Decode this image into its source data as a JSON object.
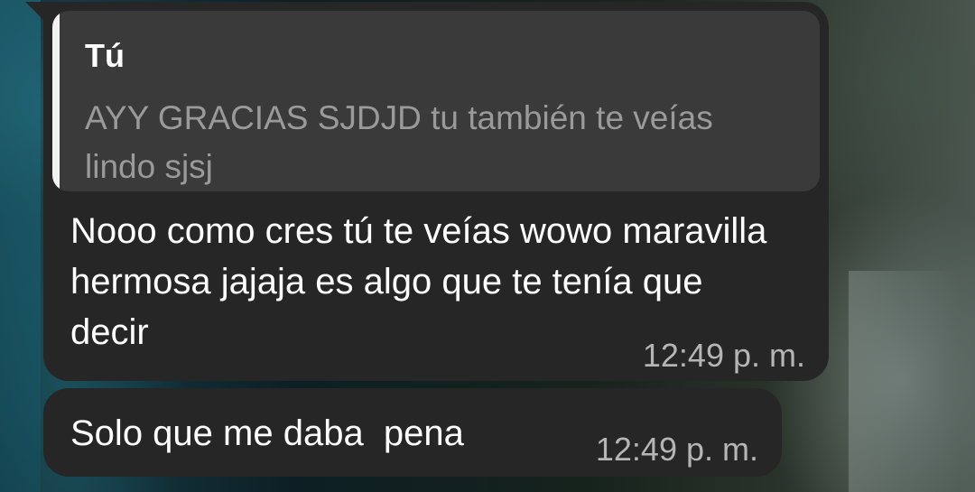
{
  "messages": [
    {
      "quoted": {
        "author": "Tú",
        "text": "AYY GRACIAS SJDJD tu también te veías lindo sjsj"
      },
      "text": "Nooo como cres tú te veías wowo maravilla hermosa jajaja  es algo que te tenía que decir",
      "time": "12:49 p. m."
    },
    {
      "text": "Solo que me daba  pena",
      "time": "12:49 p. m."
    }
  ],
  "colors": {
    "bubble": "#262626",
    "quote_background": "#3a3a3a",
    "quote_bar": "#f2f2f2",
    "text": "#ffffff",
    "quoted_text": "#9a9a9a",
    "time": "#b5b5b5"
  }
}
